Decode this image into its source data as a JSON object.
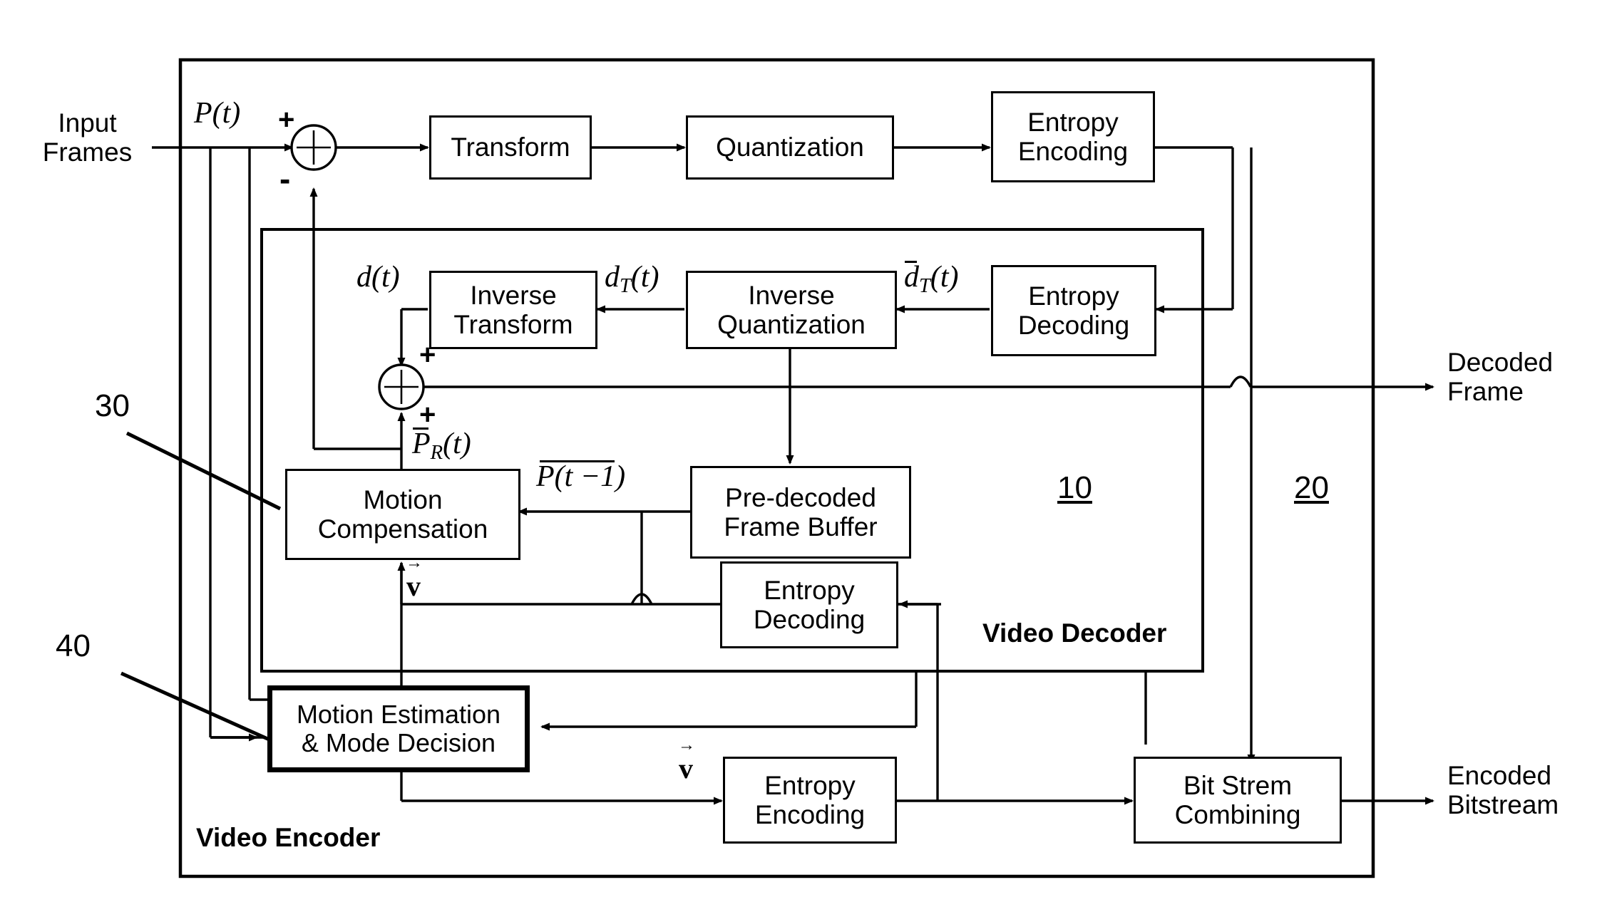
{
  "diagram": {
    "title": "Video encoder / decoder block diagram",
    "outer_label": "Video Encoder",
    "inner_label": "Video Decoder",
    "colors": {
      "line": "#000000",
      "background": "#ffffff",
      "box_fill": "#ffffff"
    }
  },
  "io_labels": {
    "input": "Input\nFrames",
    "decoded_frame": "Decoded\nFrame",
    "encoded_bitstream": "Encoded\nBitstream"
  },
  "reference_numerals": {
    "encoder": "30",
    "motion_estimation": "40",
    "decoder": "10",
    "output_stage": "20"
  },
  "blocks": [
    {
      "id": "transform",
      "label": "Transform"
    },
    {
      "id": "quantization",
      "label": "Quantization"
    },
    {
      "id": "entropy_encoding_top",
      "label": "Entropy\nEncoding"
    },
    {
      "id": "inverse_transform",
      "label": "Inverse\nTransform"
    },
    {
      "id": "inverse_quantization",
      "label": "Inverse\nQuantization"
    },
    {
      "id": "entropy_decoding_top",
      "label": "Entropy\nDecoding"
    },
    {
      "id": "motion_compensation",
      "label": "Motion\nCompensation"
    },
    {
      "id": "pre_decoded_buffer",
      "label": "Pre-decoded\nFrame Buffer"
    },
    {
      "id": "entropy_decoding_mv",
      "label": "Entropy\nDecoding"
    },
    {
      "id": "motion_estimation",
      "label": "Motion Estimation\n& Mode Decision"
    },
    {
      "id": "entropy_encoding_mv",
      "label": "Entropy\nEncoding"
    },
    {
      "id": "bit_stream_combining",
      "label": "Bit Strem\nCombining"
    }
  ],
  "signal_labels": {
    "p_t": "P(t)",
    "d_t": "d(t)",
    "d_T_t": "d",
    "d_T_t_sub": "T",
    "d_T_t_arg": "(t)",
    "d_bar_T_t": "d",
    "p_bar_R_t": "P",
    "p_bar_R_t_sub": "R",
    "p_bar_R_t_arg": "(t)",
    "p_bar_t_minus_1": "P(t −1)",
    "mv_top": "v",
    "mv_bottom": "v",
    "plus": "+",
    "minus": "-"
  },
  "adders": [
    {
      "id": "adder-subtract",
      "inputs": [
        "+",
        "-"
      ],
      "glyph": "plus-circle-icon"
    },
    {
      "id": "adder-sum",
      "inputs": [
        "+",
        "+"
      ],
      "glyph": "plus-circle-icon"
    }
  ]
}
